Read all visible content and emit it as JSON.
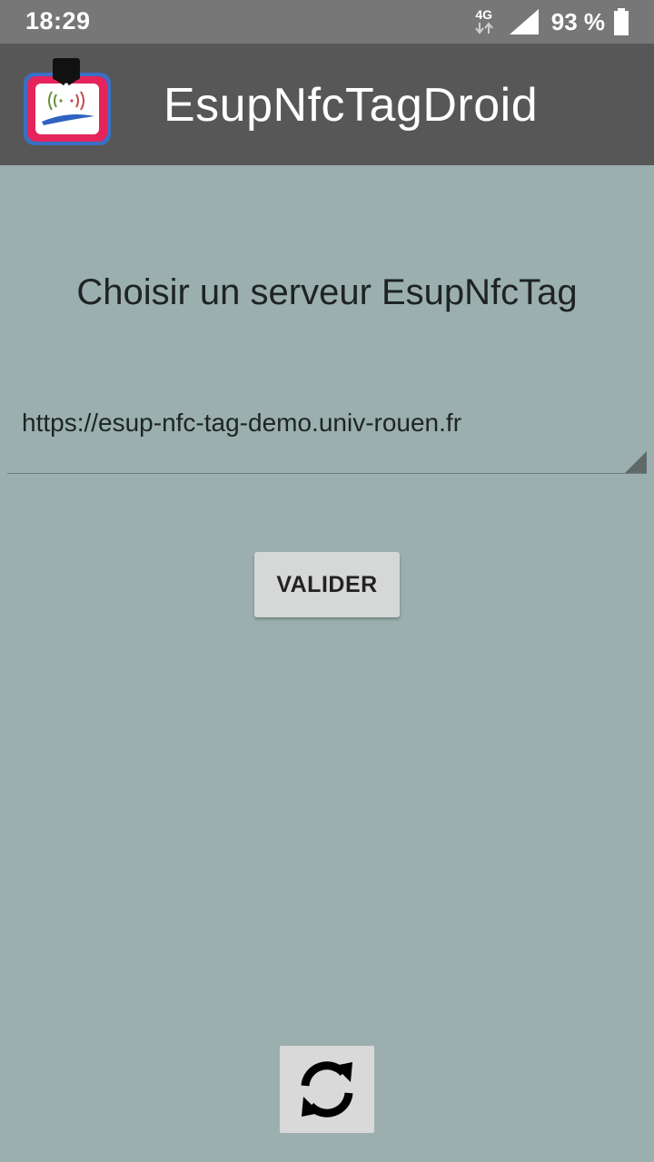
{
  "status_bar": {
    "time": "18:29",
    "network_type": "4G",
    "battery": "93 %",
    "icons": [
      "network-type-icon",
      "signal-icon",
      "battery-icon"
    ]
  },
  "app_bar": {
    "title": "EsupNfcTagDroid",
    "logo_icon": "esup-nfc-logo-icon",
    "background_color": "#575757"
  },
  "main": {
    "heading": "Choisir un serveur EsupNfcTag",
    "server_select": {
      "selected_value": "https://esup-nfc-tag-demo.univ-rouen.fr"
    },
    "validate_label": "VALIDER",
    "refresh_icon": "refresh-icon",
    "background_color": "#9bb0ae"
  }
}
